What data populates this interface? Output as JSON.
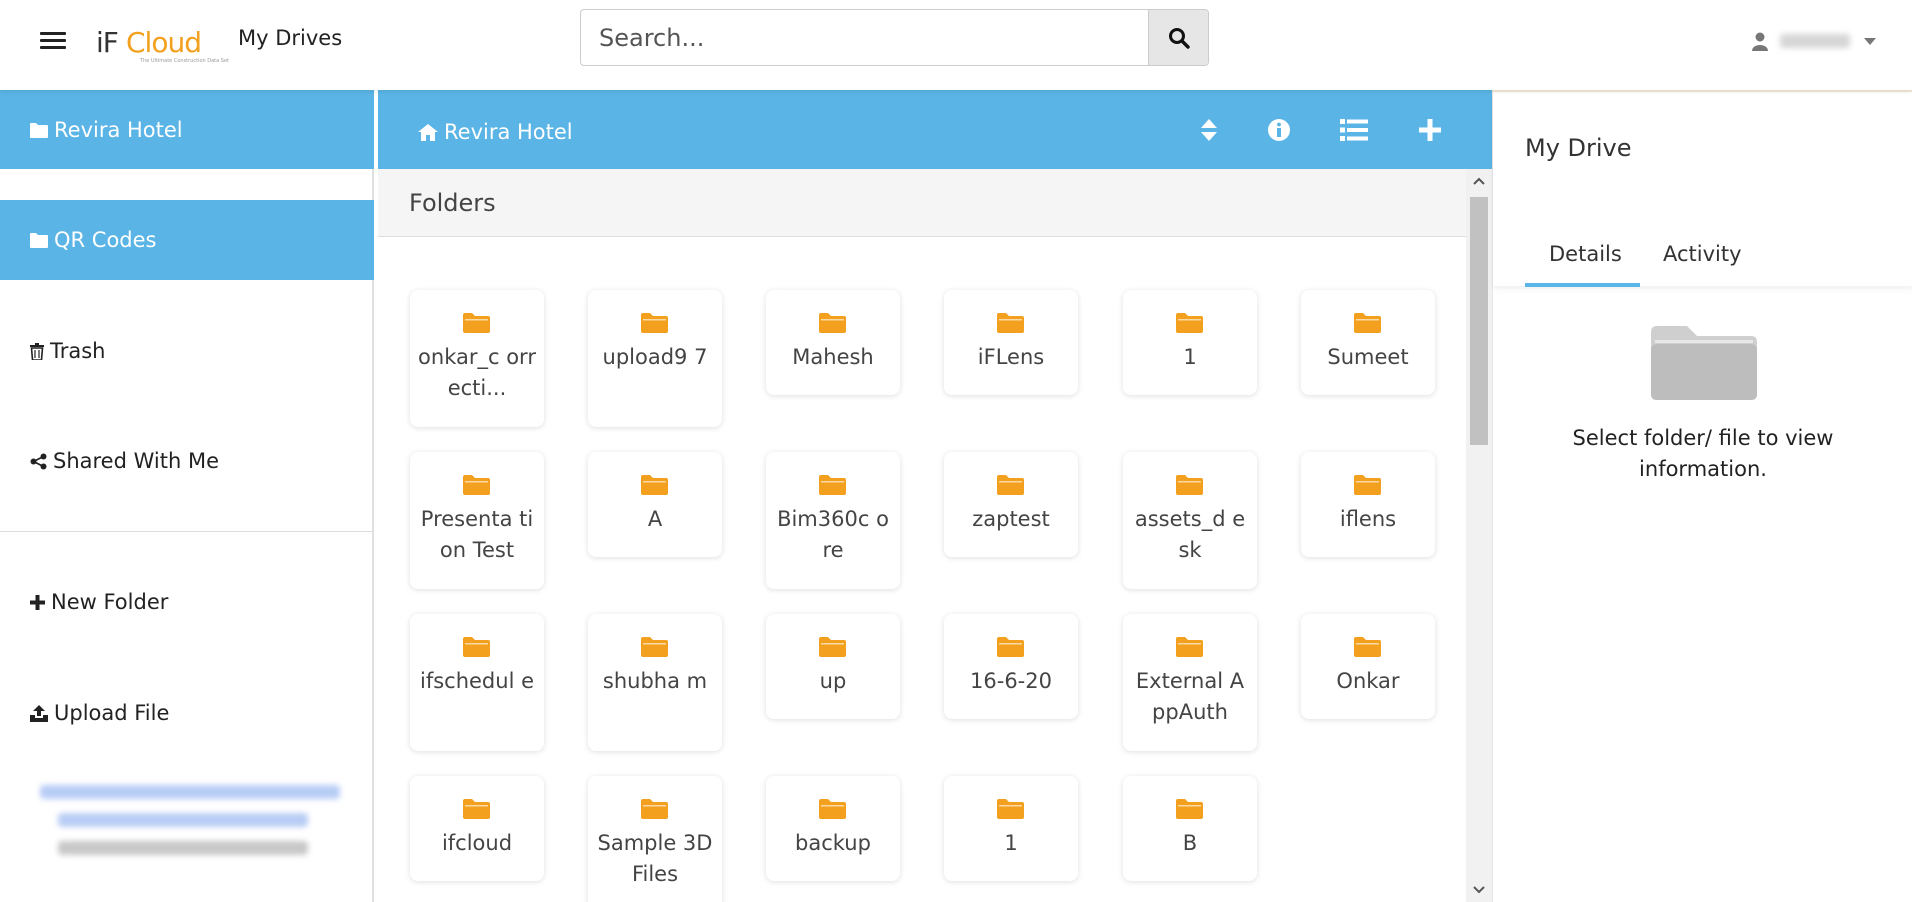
{
  "header": {
    "app_title": "My Drives",
    "logo_if": "iF",
    "logo_cloud": "Cloud",
    "logo_tagline": "The Ultimate Construction Data Set",
    "search_placeholder": "Search..."
  },
  "sidebar": {
    "items": [
      {
        "label": "Revira Hotel",
        "icon": "folder-icon",
        "active": true
      },
      {
        "label": "QR Codes",
        "icon": "folder-icon",
        "active": true
      },
      {
        "label": "Trash",
        "icon": "trash-icon",
        "active": false
      },
      {
        "label": "Shared With Me",
        "icon": "share-icon",
        "active": false
      },
      {
        "label": "New Folder",
        "icon": "plus-icon",
        "active": false
      },
      {
        "label": "Upload File",
        "icon": "upload-icon",
        "active": false
      }
    ]
  },
  "main": {
    "breadcrumb": "Revira Hotel",
    "section_title": "Folders",
    "folders": [
      "onkar_c orrecti...",
      "upload9 7",
      "Mahesh",
      "iFLens",
      "1",
      "Sumeet",
      "Presenta tion Test",
      "A",
      "Bim360c ore",
      "zaptest",
      "assets_d esk",
      "iflens",
      "ifschedul e",
      "shubha m",
      "up",
      "16-6-20",
      "External AppAuth",
      "Onkar",
      "ifcloud",
      "Sample 3D Files",
      "backup",
      "1",
      "B"
    ]
  },
  "right_panel": {
    "title": "My Drive",
    "tabs": [
      "Details",
      "Activity"
    ],
    "empty_message": "Select folder/ file to view information."
  },
  "colors": {
    "accent": "#5ab4e5",
    "folder": "#f2a01e",
    "logo_orange": "#f2a01e"
  }
}
